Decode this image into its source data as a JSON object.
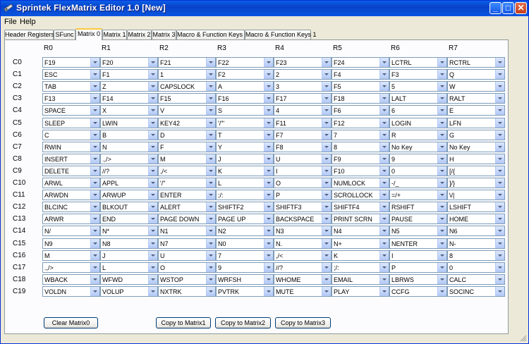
{
  "window": {
    "title": "Sprintek FlexMatrix Editor 1.0  [New]"
  },
  "titlebar": {
    "minimize": "_",
    "maximize": "□",
    "close": "✕"
  },
  "menu": [
    "File",
    "Help"
  ],
  "tabs": [
    "Header Registers",
    "SFunc",
    "Matrix 0",
    "Matrix 1",
    "Matrix 2",
    "Matrix 3",
    "Macro & Function Keys 0",
    "Macro & Function Keys 1"
  ],
  "active_tab": "Matrix 0",
  "columns": [
    "R0",
    "R1",
    "R2",
    "R3",
    "R4",
    "R5",
    "R6",
    "R7"
  ],
  "rows": [
    {
      "label": "C0",
      "cells": [
        "F19",
        "F20",
        "F21",
        "F22",
        "F23",
        "F24",
        "LCTRL",
        "RCTRL"
      ]
    },
    {
      "label": "C1",
      "cells": [
        "ESC",
        "F1",
        "1",
        "F2",
        "2",
        "F4",
        "F3",
        "Q"
      ]
    },
    {
      "label": "C2",
      "cells": [
        "TAB",
        "Z",
        "CAPSLOCK",
        "A",
        "3",
        "F5",
        "5",
        "W"
      ]
    },
    {
      "label": "C3",
      "cells": [
        "F13",
        "F14",
        "F15",
        "F16",
        "F17",
        "F18",
        "LALT",
        "RALT"
      ]
    },
    {
      "label": "C4",
      "cells": [
        "SPACE",
        "X",
        "V",
        "S",
        "4",
        "F6",
        "6",
        "E"
      ]
    },
    {
      "label": "C5",
      "cells": [
        "SLEEP",
        "LWIN",
        "KEY42",
        "'/'\"",
        "F11",
        "F12",
        "LOGIN",
        "LFN"
      ]
    },
    {
      "label": "C6",
      "cells": [
        "C",
        "B",
        "D",
        "T",
        "F7",
        "7",
        "R",
        "G"
      ]
    },
    {
      "label": "C7",
      "cells": [
        "RWIN",
        "N",
        "F",
        "Y",
        "F8",
        "8",
        "No Key",
        "No Key"
      ]
    },
    {
      "label": "C8",
      "cells": [
        "INSERT",
        ".,/>",
        "M",
        "J",
        "U",
        "F9",
        "9",
        "H"
      ]
    },
    {
      "label": "C9",
      "cells": [
        "DELETE",
        "//?",
        ",/<",
        "K",
        "I",
        "F10",
        "0",
        "[/{"
      ]
    },
    {
      "label": "C10",
      "cells": [
        "ARWL",
        "APPL",
        "'/\"",
        "L",
        "O",
        "NUMLOCK",
        "-/_",
        "]/}"
      ]
    },
    {
      "label": "C11",
      "cells": [
        "ARWDN",
        "ARWUP",
        "ENTER",
        ";/:",
        "P",
        "SCROLLOCK",
        "=/+",
        "\\/|"
      ]
    },
    {
      "label": "C12",
      "cells": [
        "BLCINC",
        "BLKOUT",
        "ALERT",
        "SHIFTF2",
        "SHIFTF3",
        "SHIFTF4",
        "RSHIFT",
        "LSHIFT"
      ]
    },
    {
      "label": "C13",
      "cells": [
        "ARWR",
        "END",
        "PAGE DOWN",
        "PAGE UP",
        "BACKSPACE",
        "PRINT SCRN",
        "PAUSE",
        "HOME"
      ]
    },
    {
      "label": "C14",
      "cells": [
        "N/",
        "N*",
        "N1",
        "N2",
        "N3",
        "N4",
        "N5",
        "N6"
      ]
    },
    {
      "label": "C15",
      "cells": [
        "N9",
        "N8",
        "N7",
        "N0",
        "N.",
        "N+",
        "NENTER",
        "N-"
      ]
    },
    {
      "label": "C16",
      "cells": [
        "M",
        "J",
        "U",
        "7",
        ",/<",
        "K",
        "I",
        "8"
      ]
    },
    {
      "label": "C17",
      "cells": [
        ".,/>",
        "L",
        "O",
        "9",
        "//?",
        ";/:",
        "P",
        "0"
      ]
    },
    {
      "label": "C18",
      "cells": [
        "WBACK",
        "WFWD",
        "WSTOP",
        "WRFSH",
        "WHOME",
        "EMAIL",
        "LBRWS",
        "CALC"
      ]
    },
    {
      "label": "C19",
      "cells": [
        "VOLDN",
        "VOLUP",
        "NXTRK",
        "PVTRK",
        "MUTE",
        "PLAY",
        "CCFG",
        "SOCINC"
      ]
    }
  ],
  "buttons": {
    "clear": "Clear Matrix0",
    "copy1": "Copy to Matrix1",
    "copy2": "Copy to Matrix2",
    "copy3": "Copy to Matrix3"
  }
}
